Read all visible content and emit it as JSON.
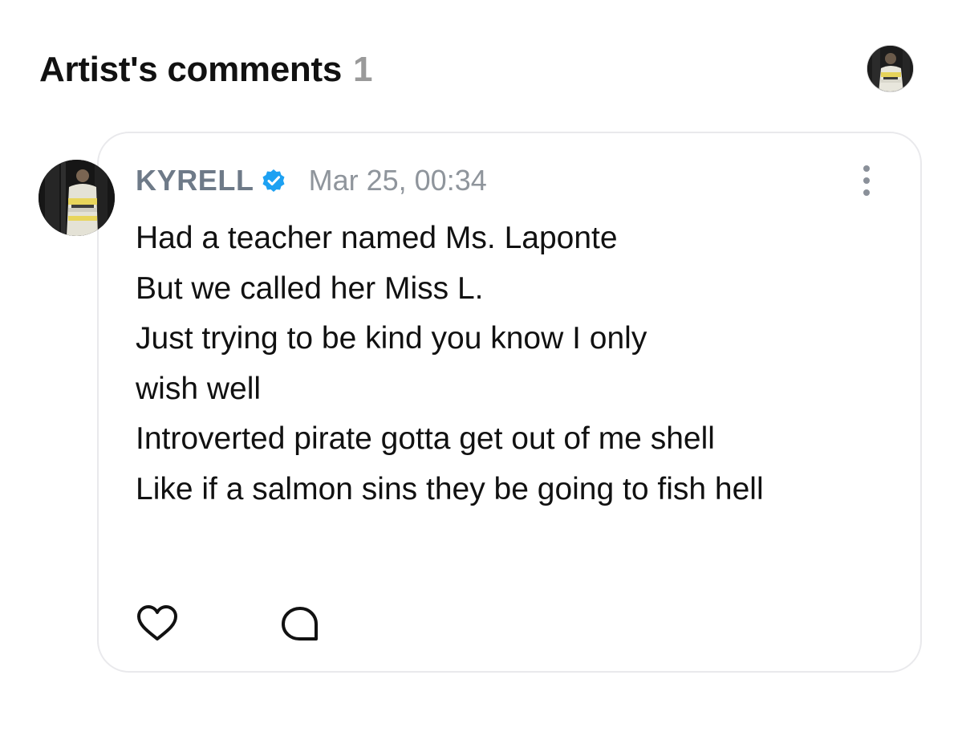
{
  "section": {
    "title": "Artist's comments",
    "count": "1"
  },
  "comment": {
    "author": "KYRELL",
    "verified": true,
    "timestamp": "Mar 25, 00:34",
    "lines": [
      "Had a teacher named Ms. Laponte",
      "But we called her Miss L.",
      "Just trying to be kind you know I only",
      "wish well",
      "Introverted pirate gotta get out of me shell",
      "Like if a salmon sins they be going to fish hell"
    ]
  },
  "icons": {
    "header_avatar": "user-avatar-icon",
    "author_avatar": "author-avatar-icon",
    "verified": "verified-check-icon",
    "more": "more-vertical-icon",
    "like": "heart-outline-icon",
    "reply": "comment-bubble-icon"
  },
  "colors": {
    "author": "#6e7a88",
    "verified_badge": "#1da1f2",
    "timestamp": "#8f959c",
    "count": "#9a9a9a",
    "card_border": "#e9e9ec"
  }
}
